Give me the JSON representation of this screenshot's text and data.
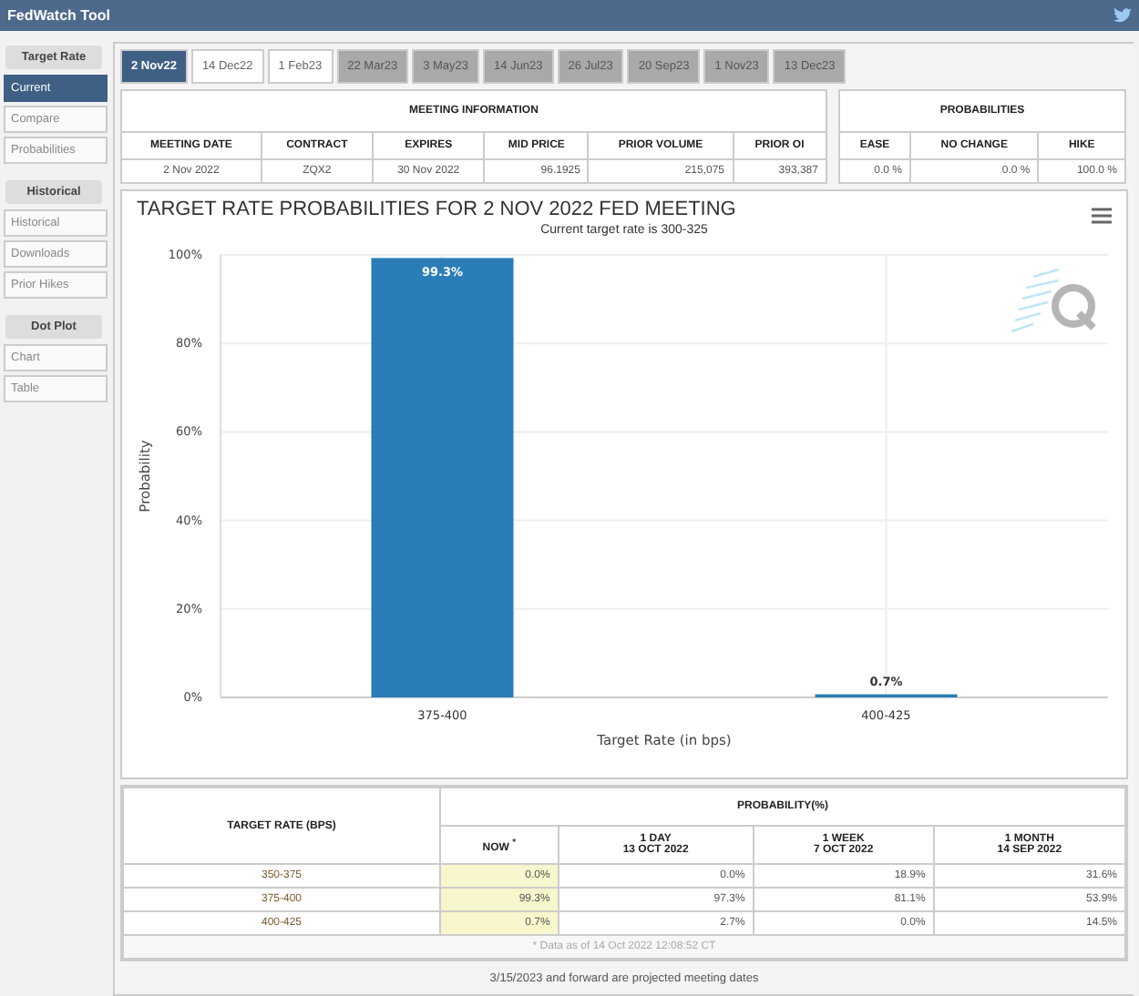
{
  "window": {
    "title": "FedWatch Tool"
  },
  "sidebar": {
    "sections": [
      {
        "heading": "Target Rate",
        "items": [
          {
            "label": "Current",
            "selected": true
          },
          {
            "label": "Compare",
            "selected": false
          },
          {
            "label": "Probabilities",
            "selected": false
          }
        ]
      },
      {
        "heading": "Historical",
        "items": [
          {
            "label": "Historical",
            "selected": false
          },
          {
            "label": "Downloads",
            "selected": false
          },
          {
            "label": "Prior Hikes",
            "selected": false
          }
        ]
      },
      {
        "heading": "Dot Plot",
        "items": [
          {
            "label": "Chart",
            "selected": false
          },
          {
            "label": "Table",
            "selected": false
          }
        ]
      }
    ]
  },
  "tabs": [
    {
      "label": "2 Nov22",
      "selected": true,
      "projected": false
    },
    {
      "label": "14 Dec22",
      "selected": false,
      "projected": false
    },
    {
      "label": "1 Feb23",
      "selected": false,
      "projected": false
    },
    {
      "label": "22 Mar23",
      "selected": false,
      "projected": true
    },
    {
      "label": "3 May23",
      "selected": false,
      "projected": true
    },
    {
      "label": "14 Jun23",
      "selected": false,
      "projected": true
    },
    {
      "label": "26 Jul23",
      "selected": false,
      "projected": true
    },
    {
      "label": "20 Sep23",
      "selected": false,
      "projected": true
    },
    {
      "label": "1 Nov23",
      "selected": false,
      "projected": true
    },
    {
      "label": "13 Dec23",
      "selected": false,
      "projected": true
    }
  ],
  "meeting_information": {
    "heading": "MEETING INFORMATION",
    "columns": [
      "MEETING DATE",
      "CONTRACT",
      "EXPIRES",
      "MID PRICE",
      "PRIOR VOLUME",
      "PRIOR OI"
    ],
    "row": [
      "2 Nov 2022",
      "ZQX2",
      "30 Nov 2022",
      "96.1925",
      "215,075",
      "393,387"
    ]
  },
  "probabilities": {
    "heading": "PROBABILITIES",
    "columns": [
      "EASE",
      "NO CHANGE",
      "HIKE"
    ],
    "row": [
      "0.0 %",
      "0.0 %",
      "100.0 %"
    ]
  },
  "chart": {
    "subtitle": "Current target rate is 300-325",
    "chart_data": {
      "type": "bar",
      "title": "TARGET RATE PROBABILITIES FOR 2 NOV 2022 FED MEETING",
      "xlabel": "Target Rate (in bps)",
      "ylabel": "Probability",
      "categories": [
        "375-400",
        "400-425"
      ],
      "series": [
        {
          "color": "#2a7db6",
          "values": [
            99.3,
            0.7
          ]
        }
      ],
      "grid": true,
      "ylim": [
        0,
        100
      ],
      "yticks": [
        {
          "value": 0,
          "label": "0%"
        },
        {
          "value": 20,
          "label": "20%"
        },
        {
          "value": 40,
          "label": "40%"
        },
        {
          "value": 60,
          "label": "60%"
        },
        {
          "value": 80,
          "label": "80%"
        },
        {
          "value": 100,
          "label": "100%"
        }
      ],
      "value_labels": [
        "99.3%",
        "0.7%"
      ]
    }
  },
  "probability_table": {
    "rate_heading": "TARGET RATE (BPS)",
    "group_heading": "PROBABILITY(%)",
    "columns": [
      {
        "line1": "NOW $^{*}$"
      },
      {
        "line1": "1 DAY",
        "line2": "13 OCT 2022"
      },
      {
        "line1": "1 WEEK",
        "line2": "7 OCT 2022"
      },
      {
        "line1": "1 MONTH",
        "line2": "14 SEP 2022"
      }
    ],
    "rows": [
      {
        "rate": "350-375",
        "values": [
          "0.0%",
          "0.0%",
          "18.9%",
          "31.6%"
        ]
      },
      {
        "rate": "375-400",
        "values": [
          "99.3%",
          "97.3%",
          "81.1%",
          "53.9%"
        ]
      },
      {
        "rate": "400-425",
        "values": [
          "0.7%",
          "2.7%",
          "0.0%",
          "14.5%"
        ]
      }
    ],
    "note": "* Data as of 14 Oct 2022 12:08:52 CT"
  },
  "footer": "3/15/2023 and forward are projected meeting dates"
}
